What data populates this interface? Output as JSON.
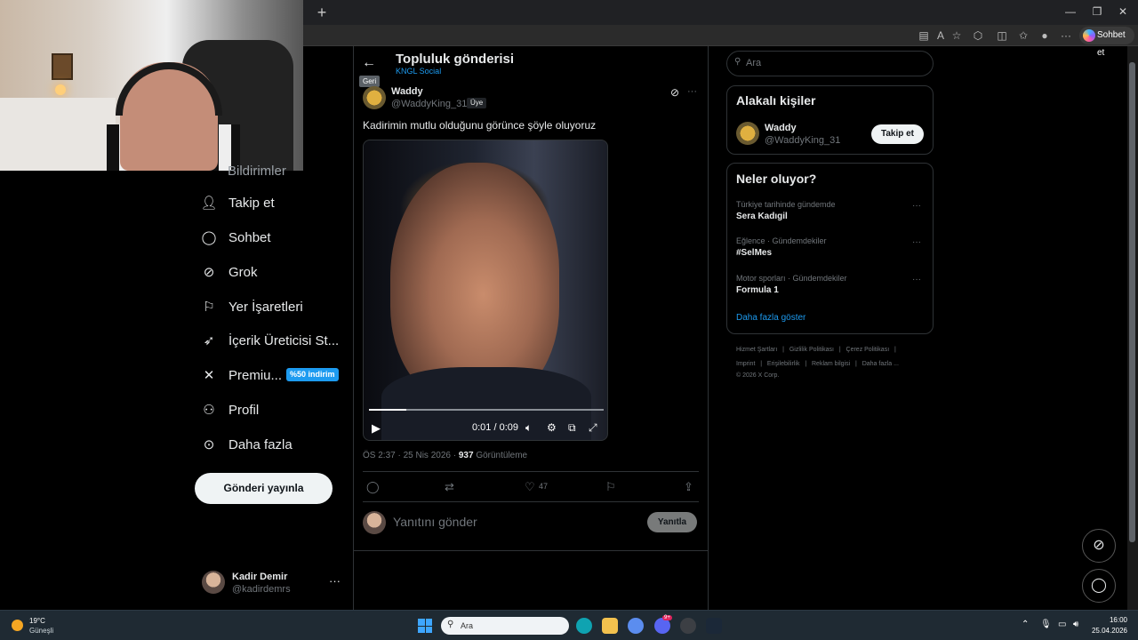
{
  "browser": {
    "new_tab": "+",
    "copilot_label": "Sohbet et"
  },
  "sidebar": {
    "partial_item": "Bildirimler",
    "items": [
      {
        "label": "Takip et",
        "icon": "add-user-icon"
      },
      {
        "label": "Sohbet",
        "icon": "chat-icon"
      },
      {
        "label": "Grok",
        "icon": "grok-icon"
      },
      {
        "label": "Yer İşaretleri",
        "icon": "bookmark-icon"
      },
      {
        "label": "İçerik Üreticisi St...",
        "icon": "rocket-icon"
      },
      {
        "label": "Premiu...",
        "icon": "x-logo-icon"
      },
      {
        "label": "Profil",
        "icon": "profile-icon"
      },
      {
        "label": "Daha fazla",
        "icon": "more-circle-icon"
      }
    ],
    "premium_badge": "%50 indirim",
    "post_button": "Gönderi yayınla",
    "account": {
      "name": "Kadir Demir",
      "handle": "@kadirdemrs",
      "more": "···"
    }
  },
  "header": {
    "back_tooltip": "Geri",
    "title": "Topluluk gönderisi",
    "community": "KNGL Social"
  },
  "post": {
    "author_name": "Waddy",
    "author_handle": "@WaddyKing_31 ·",
    "author_badge": "Üye",
    "more": "···",
    "text": "Kadirimin mutlu olduğunu görünce şöyle oluyoruz",
    "video": {
      "time": "0:01 / 0:09",
      "progress": 0.16
    },
    "meta_time": "ÖS 2:37 · 25 Nis 2026 ·",
    "views_count": "937",
    "views_label": "Görüntüleme",
    "likes": "47"
  },
  "reply": {
    "placeholder": "Yanıtını gönder",
    "button": "Yanıtla"
  },
  "right": {
    "search_placeholder": "Ara",
    "relevant_title": "Alakalı kişiler",
    "relevant_user": {
      "name": "Waddy",
      "handle": "@WaddyKing_31",
      "follow": "Takip et"
    },
    "trends_title": "Neler oluyor?",
    "trends": [
      {
        "category": "Türkiye tarihinde gündemde",
        "name": "Sera Kadıgil"
      },
      {
        "category": "Eğlence · Gündemdekiler",
        "name": "#SelMes"
      },
      {
        "category": "Motor sporları · Gündemdekiler",
        "name": "Formula 1"
      }
    ],
    "show_more": "Daha fazla göster",
    "footer_line1": [
      "Hizmet Şartları",
      "|",
      "Gizlilik Politikası",
      "|",
      "Çerez Politikası",
      "|"
    ],
    "footer_line2": [
      "Imprint",
      "|",
      "Erişilebilirlik",
      "|",
      "Reklam bilgisi",
      "|",
      "Daha fazla ..."
    ],
    "footer_copy": "© 2026 X Corp."
  },
  "taskbar": {
    "temp": "19°C",
    "weather": "Güneşli",
    "search": "Ara",
    "time": "16:00",
    "date": "25.04.2026",
    "discord_badge": "9+"
  },
  "colors": {
    "accent": "#1d9bf0",
    "bg": "#000000",
    "muted": "#71767b"
  }
}
